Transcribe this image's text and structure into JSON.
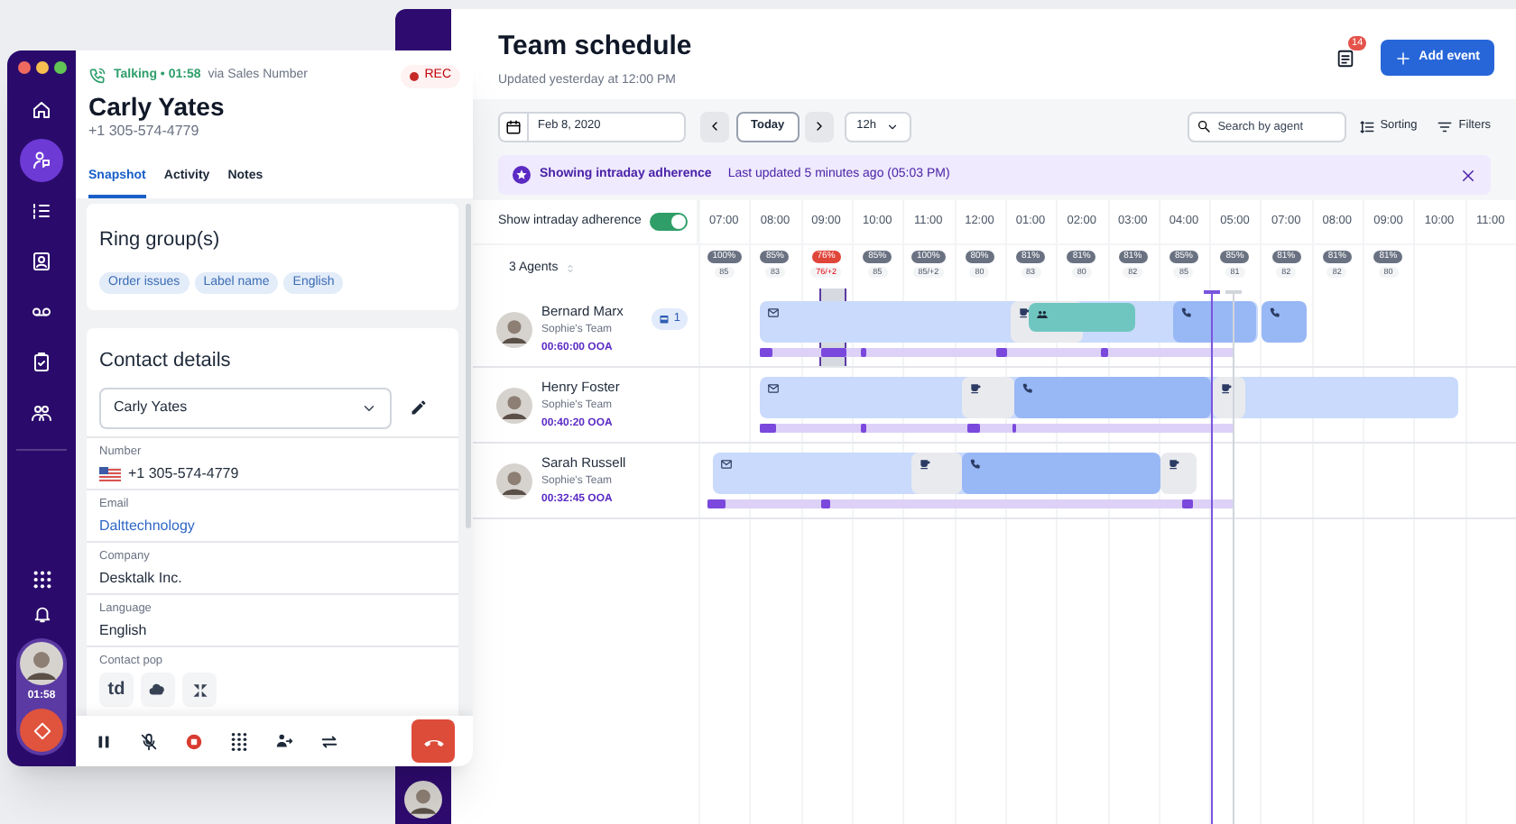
{
  "dialer": {
    "nav": [
      {
        "kind": "home",
        "selected": false
      },
      {
        "kind": "agent",
        "selected": true
      },
      {
        "kind": "list",
        "selected": false
      },
      {
        "kind": "contact",
        "selected": false
      },
      {
        "kind": "voicemail",
        "selected": false
      },
      {
        "kind": "clipboard",
        "selected": false
      },
      {
        "kind": "team",
        "selected": false
      }
    ],
    "call_timer": "01:58",
    "call": {
      "status": "Talking • 01:58",
      "via": "via Sales Number",
      "recording": "REC",
      "name": "Carly Yates",
      "phone": "+1 305-574-4779"
    },
    "tabs": [
      {
        "label": "Snapshot",
        "selected": true
      },
      {
        "label": "Activity",
        "selected": false
      },
      {
        "label": "Notes",
        "selected": false
      }
    ],
    "ring_group": {
      "title": "Ring group(s)",
      "tags": [
        "Order issues",
        "Label name",
        "English"
      ]
    },
    "contact": {
      "title": "Contact details",
      "selected_contact": "Carly Yates",
      "fields": [
        {
          "label": "Number",
          "value": "+1 305-574-4779",
          "kind": "phone"
        },
        {
          "label": "Email",
          "value": "Dalttechnology",
          "kind": "link"
        },
        {
          "label": "Company",
          "value": "Desktalk Inc.",
          "kind": "text"
        },
        {
          "label": "Language",
          "value": "English",
          "kind": "text"
        }
      ],
      "contact_pop": {
        "label": "Contact pop",
        "apps": [
          {
            "kind": "letters",
            "label": "td"
          },
          {
            "kind": "cloud"
          },
          {
            "kind": "cross"
          }
        ]
      }
    }
  },
  "schedule": {
    "title": "Team schedule",
    "updated": "Updated yesterday at 12:00 PM",
    "notifications_badge": "14",
    "add_button": "Add event",
    "date": "Feb 8, 2020",
    "today": "Today",
    "range": "12h",
    "search_placeholder": "Search by agent",
    "sorting": "Sorting",
    "filters": "Filters",
    "banner": {
      "title": "Showing intraday adherence",
      "detail": "Last updated 5 minutes ago (05:03 PM)"
    },
    "adherence_toggle": {
      "label": "Show intraday adherence",
      "on": true
    },
    "agents_count": "3 Agents",
    "hours": [
      "07:00",
      "08:00",
      "09:00",
      "10:00",
      "11:00",
      "12:00",
      "01:00",
      "02:00",
      "03:00",
      "04:00",
      "05:00",
      "07:00",
      "08:00",
      "09:00",
      "10:00",
      "11:00"
    ],
    "adherence": [
      {
        "percent": "100%",
        "count": "85",
        "alert": false
      },
      {
        "percent": "85%",
        "count": "83",
        "alert": false
      },
      {
        "percent": "76%",
        "count": "76/+2",
        "alert": true
      },
      {
        "percent": "85%",
        "count": "85",
        "alert": false
      },
      {
        "percent": "100%",
        "count": "85/+2",
        "alert": false
      },
      {
        "percent": "80%",
        "count": "80",
        "alert": false
      },
      {
        "percent": "81%",
        "count": "83",
        "alert": false
      },
      {
        "percent": "81%",
        "count": "80",
        "alert": false
      },
      {
        "percent": "81%",
        "count": "82",
        "alert": false
      },
      {
        "percent": "85%",
        "count": "85",
        "alert": false
      },
      {
        "percent": "85%",
        "count": "81",
        "alert": false
      },
      {
        "percent": "81%",
        "count": "82",
        "alert": false
      },
      {
        "percent": "81%",
        "count": "82",
        "alert": false
      },
      {
        "percent": "81%",
        "count": "80",
        "alert": false
      }
    ],
    "agents": [
      {
        "name": "Bernard Marx",
        "team": "Sophie's Team",
        "ooa": "00:60:00 OOA",
        "badge": "1"
      },
      {
        "name": "Henry Foster",
        "team": "Sophie's Team",
        "ooa": "00:40:20 OOA"
      },
      {
        "name": "Sarah Russell",
        "team": "Sophie's Team",
        "ooa": "00:32:45 OOA"
      }
    ]
  }
}
